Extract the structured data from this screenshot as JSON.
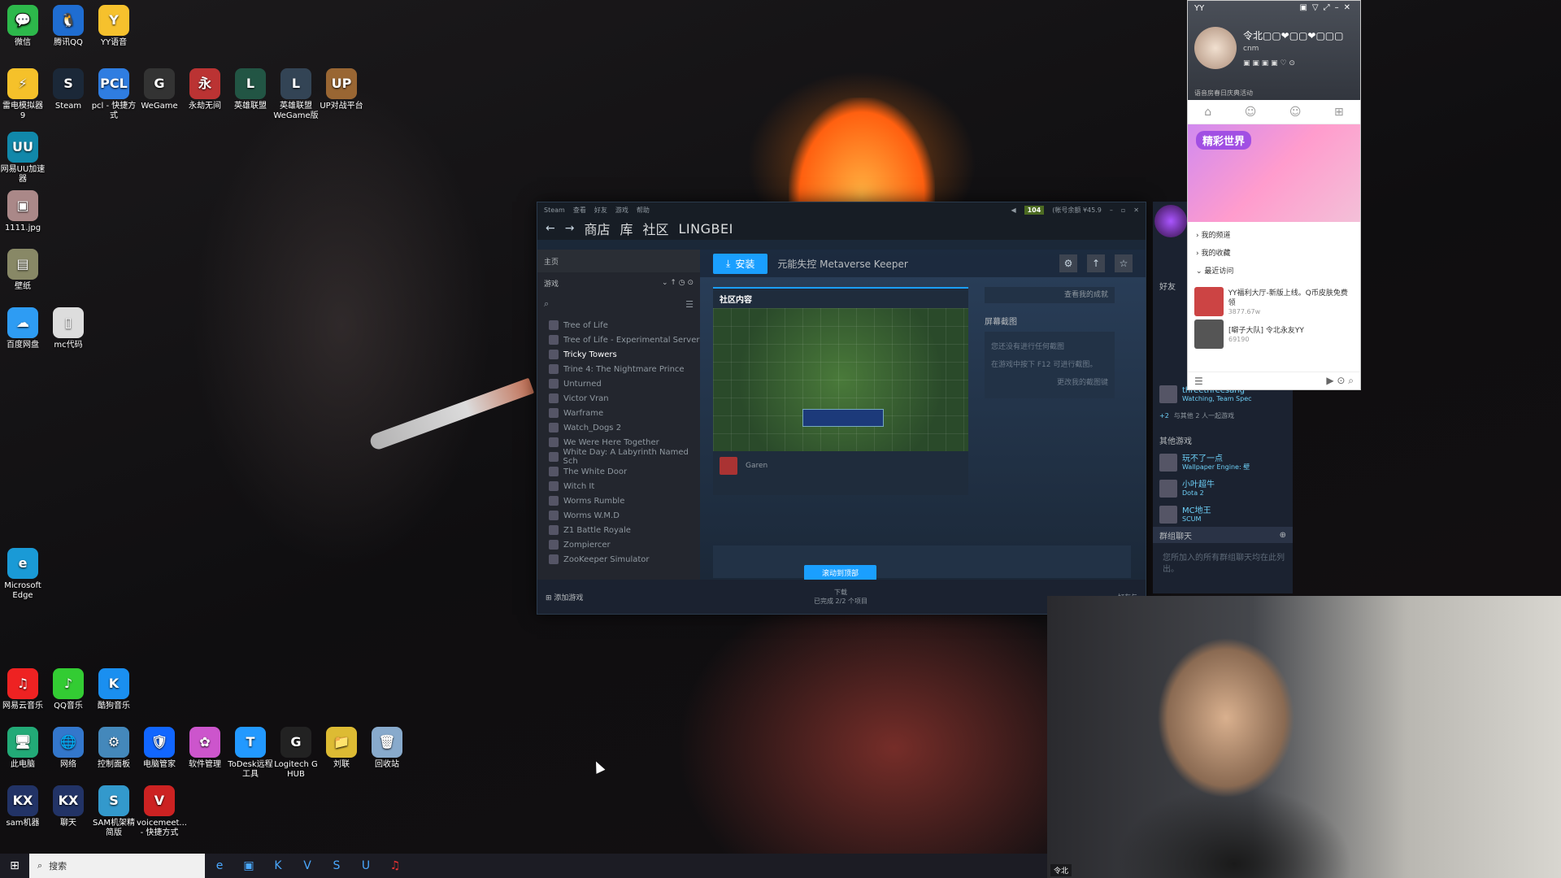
{
  "desktop": {
    "icons": [
      {
        "label": "微信",
        "glyph": "💬",
        "color": "#2db84b"
      },
      {
        "label": "腾讯QQ",
        "glyph": "🐧",
        "color": "#1f6dd1"
      },
      {
        "label": "YY语音",
        "glyph": "Y",
        "color": "#f6c12d"
      },
      {
        "label": "雷电模拟器9",
        "glyph": "⚡",
        "color": "#f5c12a"
      },
      {
        "label": "Steam",
        "glyph": "S",
        "color": "#1b2838"
      },
      {
        "label": "pcl - 快捷方式",
        "glyph": "PCL",
        "color": "#2f7de1"
      },
      {
        "label": "WeGame",
        "glyph": "G",
        "color": "#333"
      },
      {
        "label": "永劫无间",
        "glyph": "永",
        "color": "#b33"
      },
      {
        "label": "英雄联盟",
        "glyph": "L",
        "color": "#254"
      },
      {
        "label": "英雄联盟WeGame版",
        "glyph": "L",
        "color": "#345"
      },
      {
        "label": "UP对战平台",
        "glyph": "UP",
        "color": "#963"
      },
      {
        "label": "网易UU加速器",
        "glyph": "UU",
        "color": "#18a"
      },
      {
        "label": "1111.jpg",
        "glyph": "▣",
        "color": "#a88"
      },
      {
        "label": "壁纸",
        "glyph": "▤",
        "color": "#886"
      },
      {
        "label": "百度网盘",
        "glyph": "☁",
        "color": "#2e9cf3"
      },
      {
        "label": "mc代码",
        "glyph": "▯",
        "color": "#ddd"
      },
      {
        "label": "Microsoft Edge",
        "glyph": "e",
        "color": "#1a9ad6"
      },
      {
        "label": "网易云音乐",
        "glyph": "♫",
        "color": "#e22"
      },
      {
        "label": "QQ音乐",
        "glyph": "♪",
        "color": "#3c3"
      },
      {
        "label": "酷狗音乐",
        "glyph": "K",
        "color": "#1a8ff0"
      },
      {
        "label": "此电脑",
        "glyph": "🖥",
        "color": "#2a7"
      },
      {
        "label": "网络",
        "glyph": "🌐",
        "color": "#37c"
      },
      {
        "label": "控制面板",
        "glyph": "⚙",
        "color": "#48b"
      },
      {
        "label": "电脑管家",
        "glyph": "🛡",
        "color": "#16f"
      },
      {
        "label": "软件管理",
        "glyph": "✿",
        "color": "#c5c"
      },
      {
        "label": "ToDesk远程工具",
        "glyph": "T",
        "color": "#29f"
      },
      {
        "label": "Logitech G HUB",
        "glyph": "G",
        "color": "#222"
      },
      {
        "label": "刘联",
        "glyph": "📁",
        "color": "#db3"
      },
      {
        "label": "回收站",
        "glyph": "🗑",
        "color": "#8ac"
      },
      {
        "label": "sam机器",
        "glyph": "KX",
        "color": "#236"
      },
      {
        "label": "聊天",
        "glyph": "KX",
        "color": "#236"
      },
      {
        "label": "SAM机架精简版",
        "glyph": "S",
        "color": "#39c"
      },
      {
        "label": "voicemeet... - 快捷方式",
        "glyph": "V",
        "color": "#c22"
      }
    ]
  },
  "steam": {
    "menu": [
      "Steam",
      "查看",
      "好友",
      "游戏",
      "帮助"
    ],
    "wallet": "104",
    "account": "(帐号余额 ¥45.9",
    "nav": {
      "store": "商店",
      "library": "库",
      "community": "社区",
      "user": "LINGBEI"
    },
    "left": {
      "home": "主页",
      "filter": "游戏"
    },
    "games": [
      "Tree of Life",
      "Tree of Life - Experimental Server",
      "Tricky Towers",
      "Trine 4: The Nightmare Prince",
      "Unturned",
      "Victor Vran",
      "Warframe",
      "Watch_Dogs 2",
      "We Were Here Together",
      "White Day: A Labyrinth Named Sch",
      "The White Door",
      "Witch It",
      "Worms Rumble",
      "Worms W.M.D",
      "Z1 Battle Royale",
      "Zompiercer",
      "ZooKeeper Simulator"
    ],
    "install_label": "安装",
    "game_title": "元能失控 Metaverse Keeper",
    "community_header": "社区内容",
    "garen": "Garen",
    "view_achievements": "查看我的成就",
    "screenshots_header": "屏幕截图",
    "no_screenshots": "您还没有进行任何截图",
    "f12_hint": "在游戏中按下 F12 可进行截图。",
    "change_shot_key": "更改我的截图键",
    "scroll_top": "滚动到顶部",
    "add_game": "添加游戏",
    "download": "下载",
    "download_status": "已完成 2/2 个项目",
    "friends_chat": "好友与"
  },
  "friends": {
    "header": "好友",
    "watching_name": "threethreesang",
    "watching_status": "Watching, Team Spec",
    "watching_plus": "+2",
    "watching_note": "与其他 2 人一起游戏",
    "other_games": "其他游戏",
    "rows": [
      {
        "name": "玩不了一点",
        "status": "Wallpaper Engine: 壁"
      },
      {
        "name": "小叶超牛",
        "status": "Dota 2"
      },
      {
        "name": "MC地王",
        "status": "SCUM"
      }
    ],
    "group_chat": "群组聊天",
    "group_note": "您所加入的所有群组聊天均在此列出。"
  },
  "yy": {
    "title": "YY",
    "name": "令北▢▢❤▢▢❤▢▢▢",
    "sig": "cnm",
    "sub": "语音房春日庆典活动",
    "banner": "精彩世界",
    "menu": [
      "我的频道",
      "我的收藏",
      "最近访问"
    ],
    "items": [
      {
        "name": "YY福利大厅-新版上线。Q币皮肤免费领",
        "count": "3877.67w"
      },
      {
        "name": "[噼子大队] 令北永友YY",
        "count": "69190"
      }
    ]
  },
  "cam": {
    "caption": "令北"
  },
  "taskbar": {
    "search": "搜索"
  }
}
